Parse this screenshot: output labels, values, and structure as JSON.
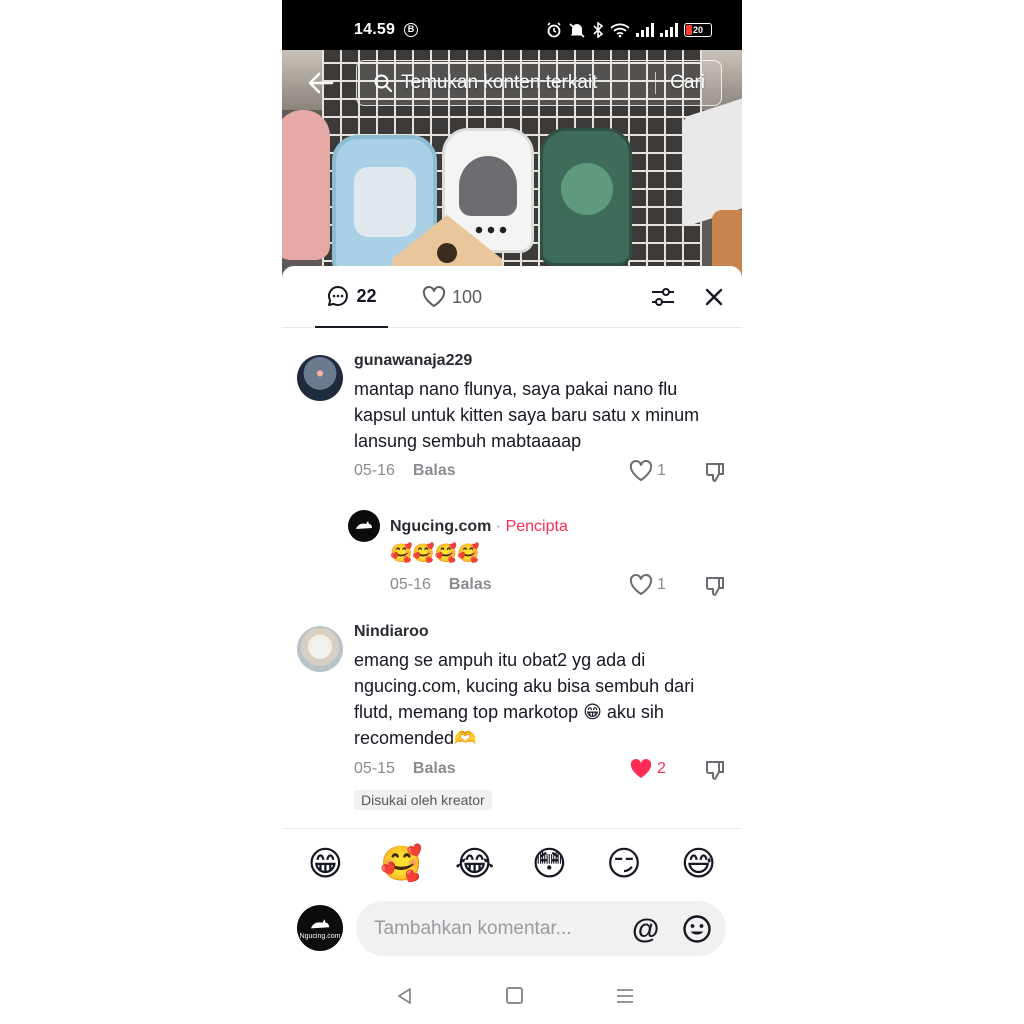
{
  "status_bar": {
    "time": "14.59",
    "badge": "B",
    "battery": "20",
    "icons": [
      "alarm-icon",
      "mute-icon",
      "bluetooth-icon",
      "wifi-icon",
      "signal-icon",
      "signal-icon",
      "battery-icon"
    ]
  },
  "search": {
    "placeholder": "Temukan konten terkait",
    "button_label": "Cari"
  },
  "tabs": {
    "comments_count": "22",
    "likes_count": "100"
  },
  "comments": [
    {
      "username": "gunawanaja229",
      "text": "mantap nano flunya, saya pakai nano flu kapsul untuk kitten saya baru satu x minum lansung sembuh mabtaaaap",
      "date": "05-16",
      "reply_label": "Balas",
      "likes": "1",
      "reply": {
        "username": "Ngucing.com",
        "separator": "·",
        "creator_tag": "Pencipta",
        "text": "🥰🥰🥰🥰",
        "date": "05-16",
        "reply_label": "Balas",
        "likes": "1"
      }
    },
    {
      "username": "Nindiaroo",
      "text": "emang se ampuh itu obat2 yg ada di ngucing.com, kucing aku bisa sembuh dari flutd, memang top markotop 😁 aku sih recomended🫶",
      "date": "05-15",
      "reply_label": "Balas",
      "likes": "2",
      "liked_badge": "Disukai oleh kreator"
    }
  ],
  "quick_emojis": [
    "😁",
    "🥰",
    "😂",
    "😳",
    "😏",
    "😅"
  ],
  "composer": {
    "avatar_label": "Ngucing.com",
    "placeholder": "Tambahkan komentar...",
    "mention_symbol": "@"
  },
  "colors": {
    "accent": "#fe2c55",
    "text": "#161823",
    "muted": "#8a8b91"
  }
}
